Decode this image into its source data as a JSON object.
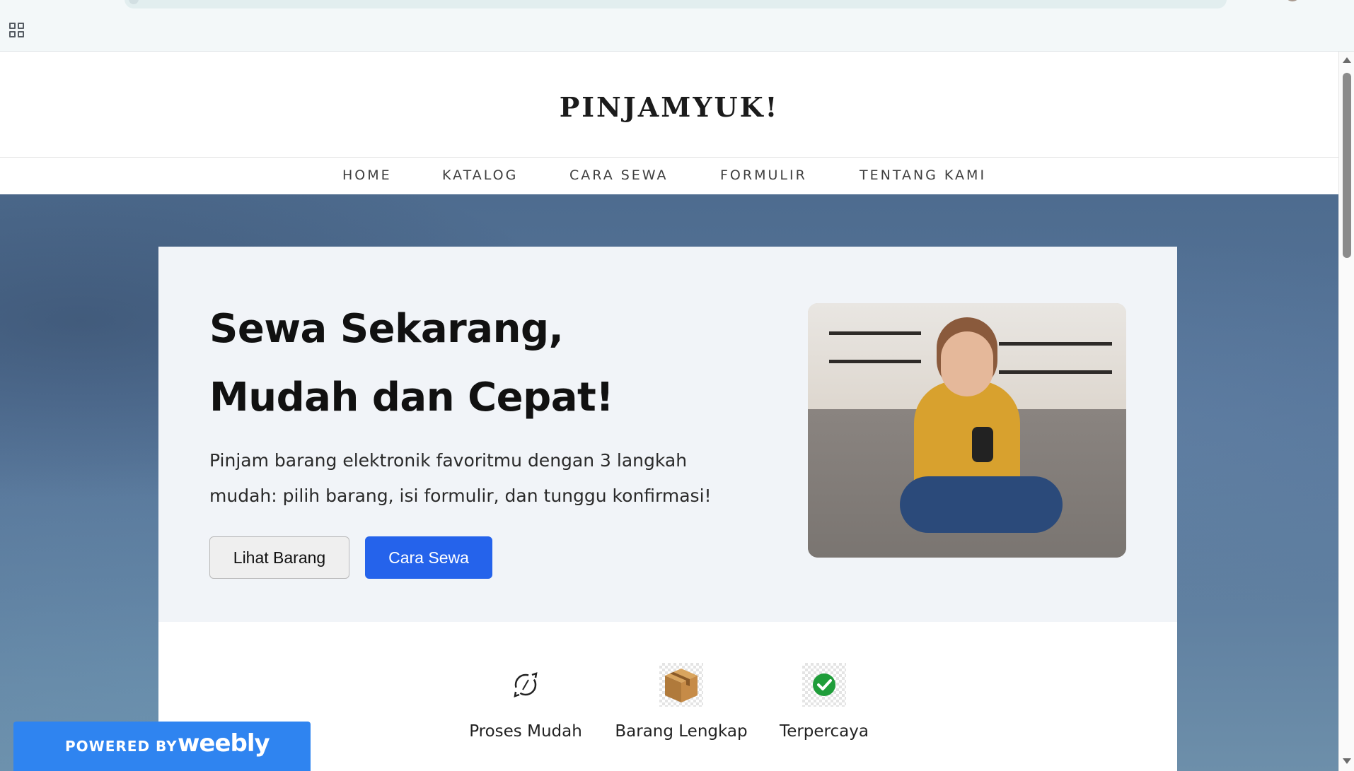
{
  "site": {
    "logo": "PINJAMYUK!"
  },
  "nav": {
    "items": [
      {
        "label": "HOME",
        "active": true
      },
      {
        "label": "KATALOG",
        "active": false
      },
      {
        "label": "CARA SEWA",
        "active": false
      },
      {
        "label": "FORMULIR",
        "active": false
      },
      {
        "label": "TENTANG KAMI",
        "active": false
      }
    ]
  },
  "hero": {
    "title": "Sewa Sekarang, Mudah dan Cepat!",
    "description": "Pinjam barang elektronik favoritmu dengan 3 langkah mudah: pilih barang, isi formulir, dan tunggu konfirmasi!",
    "buttons": {
      "secondary": "Lihat Barang",
      "primary": "Cara Sewa"
    },
    "image_icon": "woman-playing-game-controller-photo"
  },
  "features": [
    {
      "icon": "refresh-cycle-icon",
      "label": "Proses Mudah"
    },
    {
      "icon": "package-box-icon",
      "label": "Barang Lengkap"
    },
    {
      "icon": "green-check-icon",
      "label": "Terpercaya"
    }
  ],
  "badge": {
    "powered_by": "POWERED BY",
    "brand": "weebly"
  },
  "colors": {
    "primary_button": "#2563eb",
    "active_nav_underline": "#2e86de",
    "weebly_badge": "#2f84f0",
    "check_green": "#1f9d3a"
  }
}
